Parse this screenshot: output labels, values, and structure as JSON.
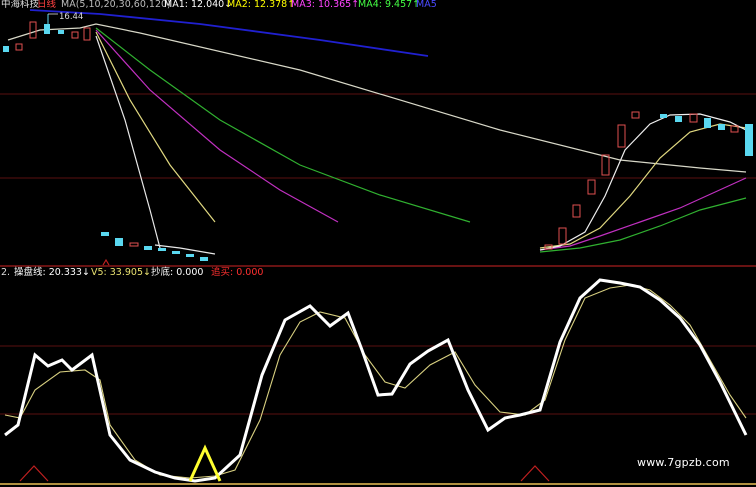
{
  "top_panel": {
    "stock_name": "中海科技",
    "period": "日线",
    "ma_params": "MA(5,10,20,30,60,120)",
    "ma1": "MA1: 12.040↓",
    "ma2": "MA2: 12.378↑",
    "ma3": "MA3: 10.365↑",
    "ma4": "MA4: 9.457↑",
    "ma5": "MA5",
    "price_marker_high": "16.44",
    "colors": {
      "ma1": "#ffffff",
      "ma2": "#ffff00",
      "ma3": "#ff00ff",
      "ma4": "#00ff00",
      "ma5": "#0000ff"
    }
  },
  "bottom_panel": {
    "index": "2.",
    "main_line": "操盘线: 20.333↓",
    "v5": "V5: 33.905↓",
    "bottom_buy": "抄底: 0.000",
    "chase_buy": "追买: 0.000",
    "colors": {
      "main": "#ffffff",
      "v5": "#e8e070",
      "bottom": "#ffffff",
      "chase": "#ff3030"
    }
  },
  "watermark": "www.7gpzb.com"
}
